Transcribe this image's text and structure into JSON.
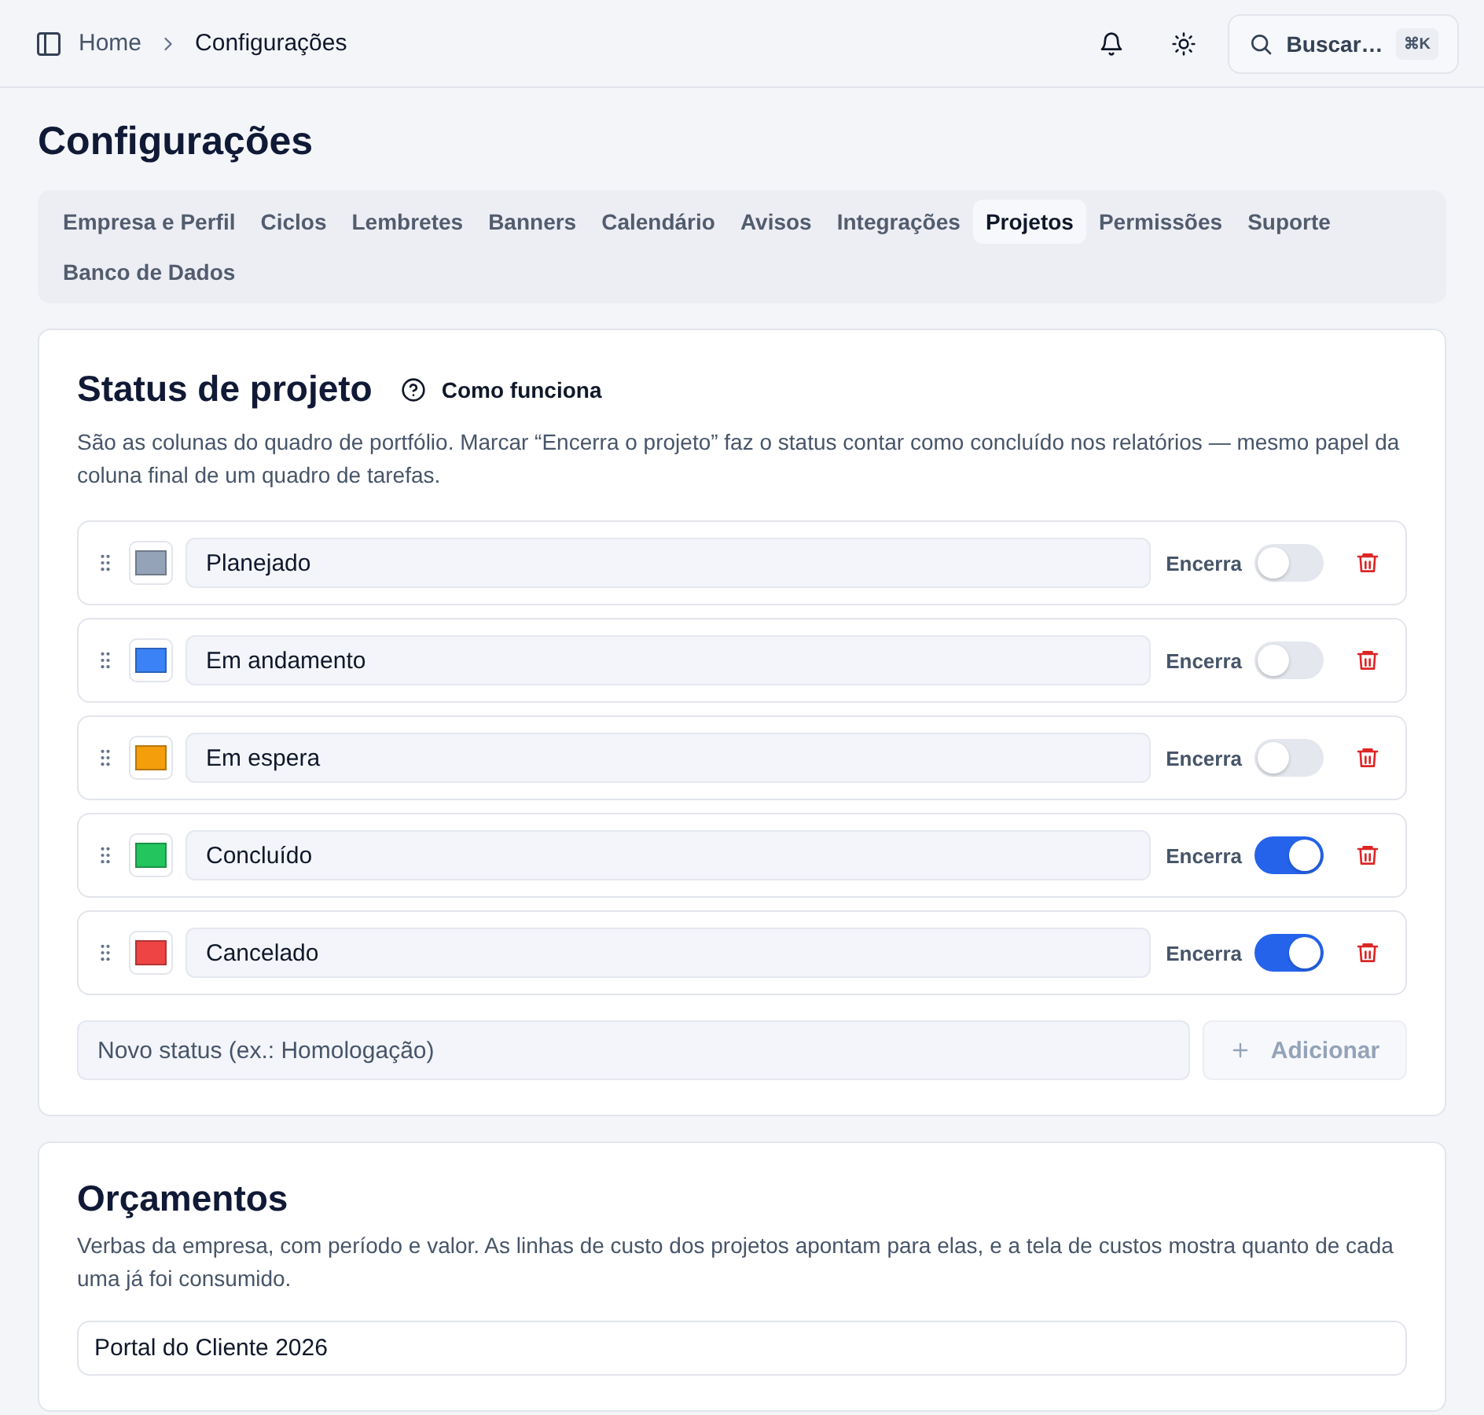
{
  "topbar": {
    "breadcrumb": [
      {
        "label": "Home"
      },
      {
        "label": "Configurações"
      }
    ],
    "search": {
      "label": "Buscar…",
      "shortcut": "⌘K"
    }
  },
  "page_title": "Configurações",
  "tabs": [
    {
      "label": "Empresa e Perfil",
      "selected": false
    },
    {
      "label": "Ciclos",
      "selected": false
    },
    {
      "label": "Lembretes",
      "selected": false
    },
    {
      "label": "Banners",
      "selected": false
    },
    {
      "label": "Calendário",
      "selected": false
    },
    {
      "label": "Avisos",
      "selected": false
    },
    {
      "label": "Integrações",
      "selected": false
    },
    {
      "label": "Projetos",
      "selected": true
    },
    {
      "label": "Permissões",
      "selected": false
    },
    {
      "label": "Suporte",
      "selected": false
    },
    {
      "label": "Banco de Dados",
      "selected": false
    }
  ],
  "status_section": {
    "title": "Status de projeto",
    "help_link": "Como funciona",
    "description": "São as colunas do quadro de portfólio. Marcar “Encerra o projeto” faz o status contar como concluído nos relatórios — mesmo papel da coluna final de um quadro de tarefas.",
    "statuses": [
      {
        "name": "Planejado",
        "color": "#94a3b8",
        "toggle_label": "Encerra",
        "on": false
      },
      {
        "name": "Em andamento",
        "color": "#3b82f6",
        "toggle_label": "Encerra",
        "on": false
      },
      {
        "name": "Em espera",
        "color": "#f59e0b",
        "toggle_label": "Encerra",
        "on": false
      },
      {
        "name": "Concluído",
        "color": "#22c55e",
        "toggle_label": "Encerra",
        "on": true
      },
      {
        "name": "Cancelado",
        "color": "#ef4444",
        "toggle_label": "Encerra",
        "on": true
      }
    ],
    "new_status": {
      "placeholder": "Novo status (ex.: Homologação)"
    },
    "add_button": {
      "label": "Adicionar",
      "disabled": true
    }
  },
  "budgets_section": {
    "title": "Orçamentos",
    "description": "Verbas da empresa, com período e valor. As linhas de custo dos projetos apontam para elas, e a tela de custos mostra quanto de cada uma já foi consumido.",
    "items": [
      {
        "name": "Portal do Cliente 2026"
      }
    ]
  }
}
